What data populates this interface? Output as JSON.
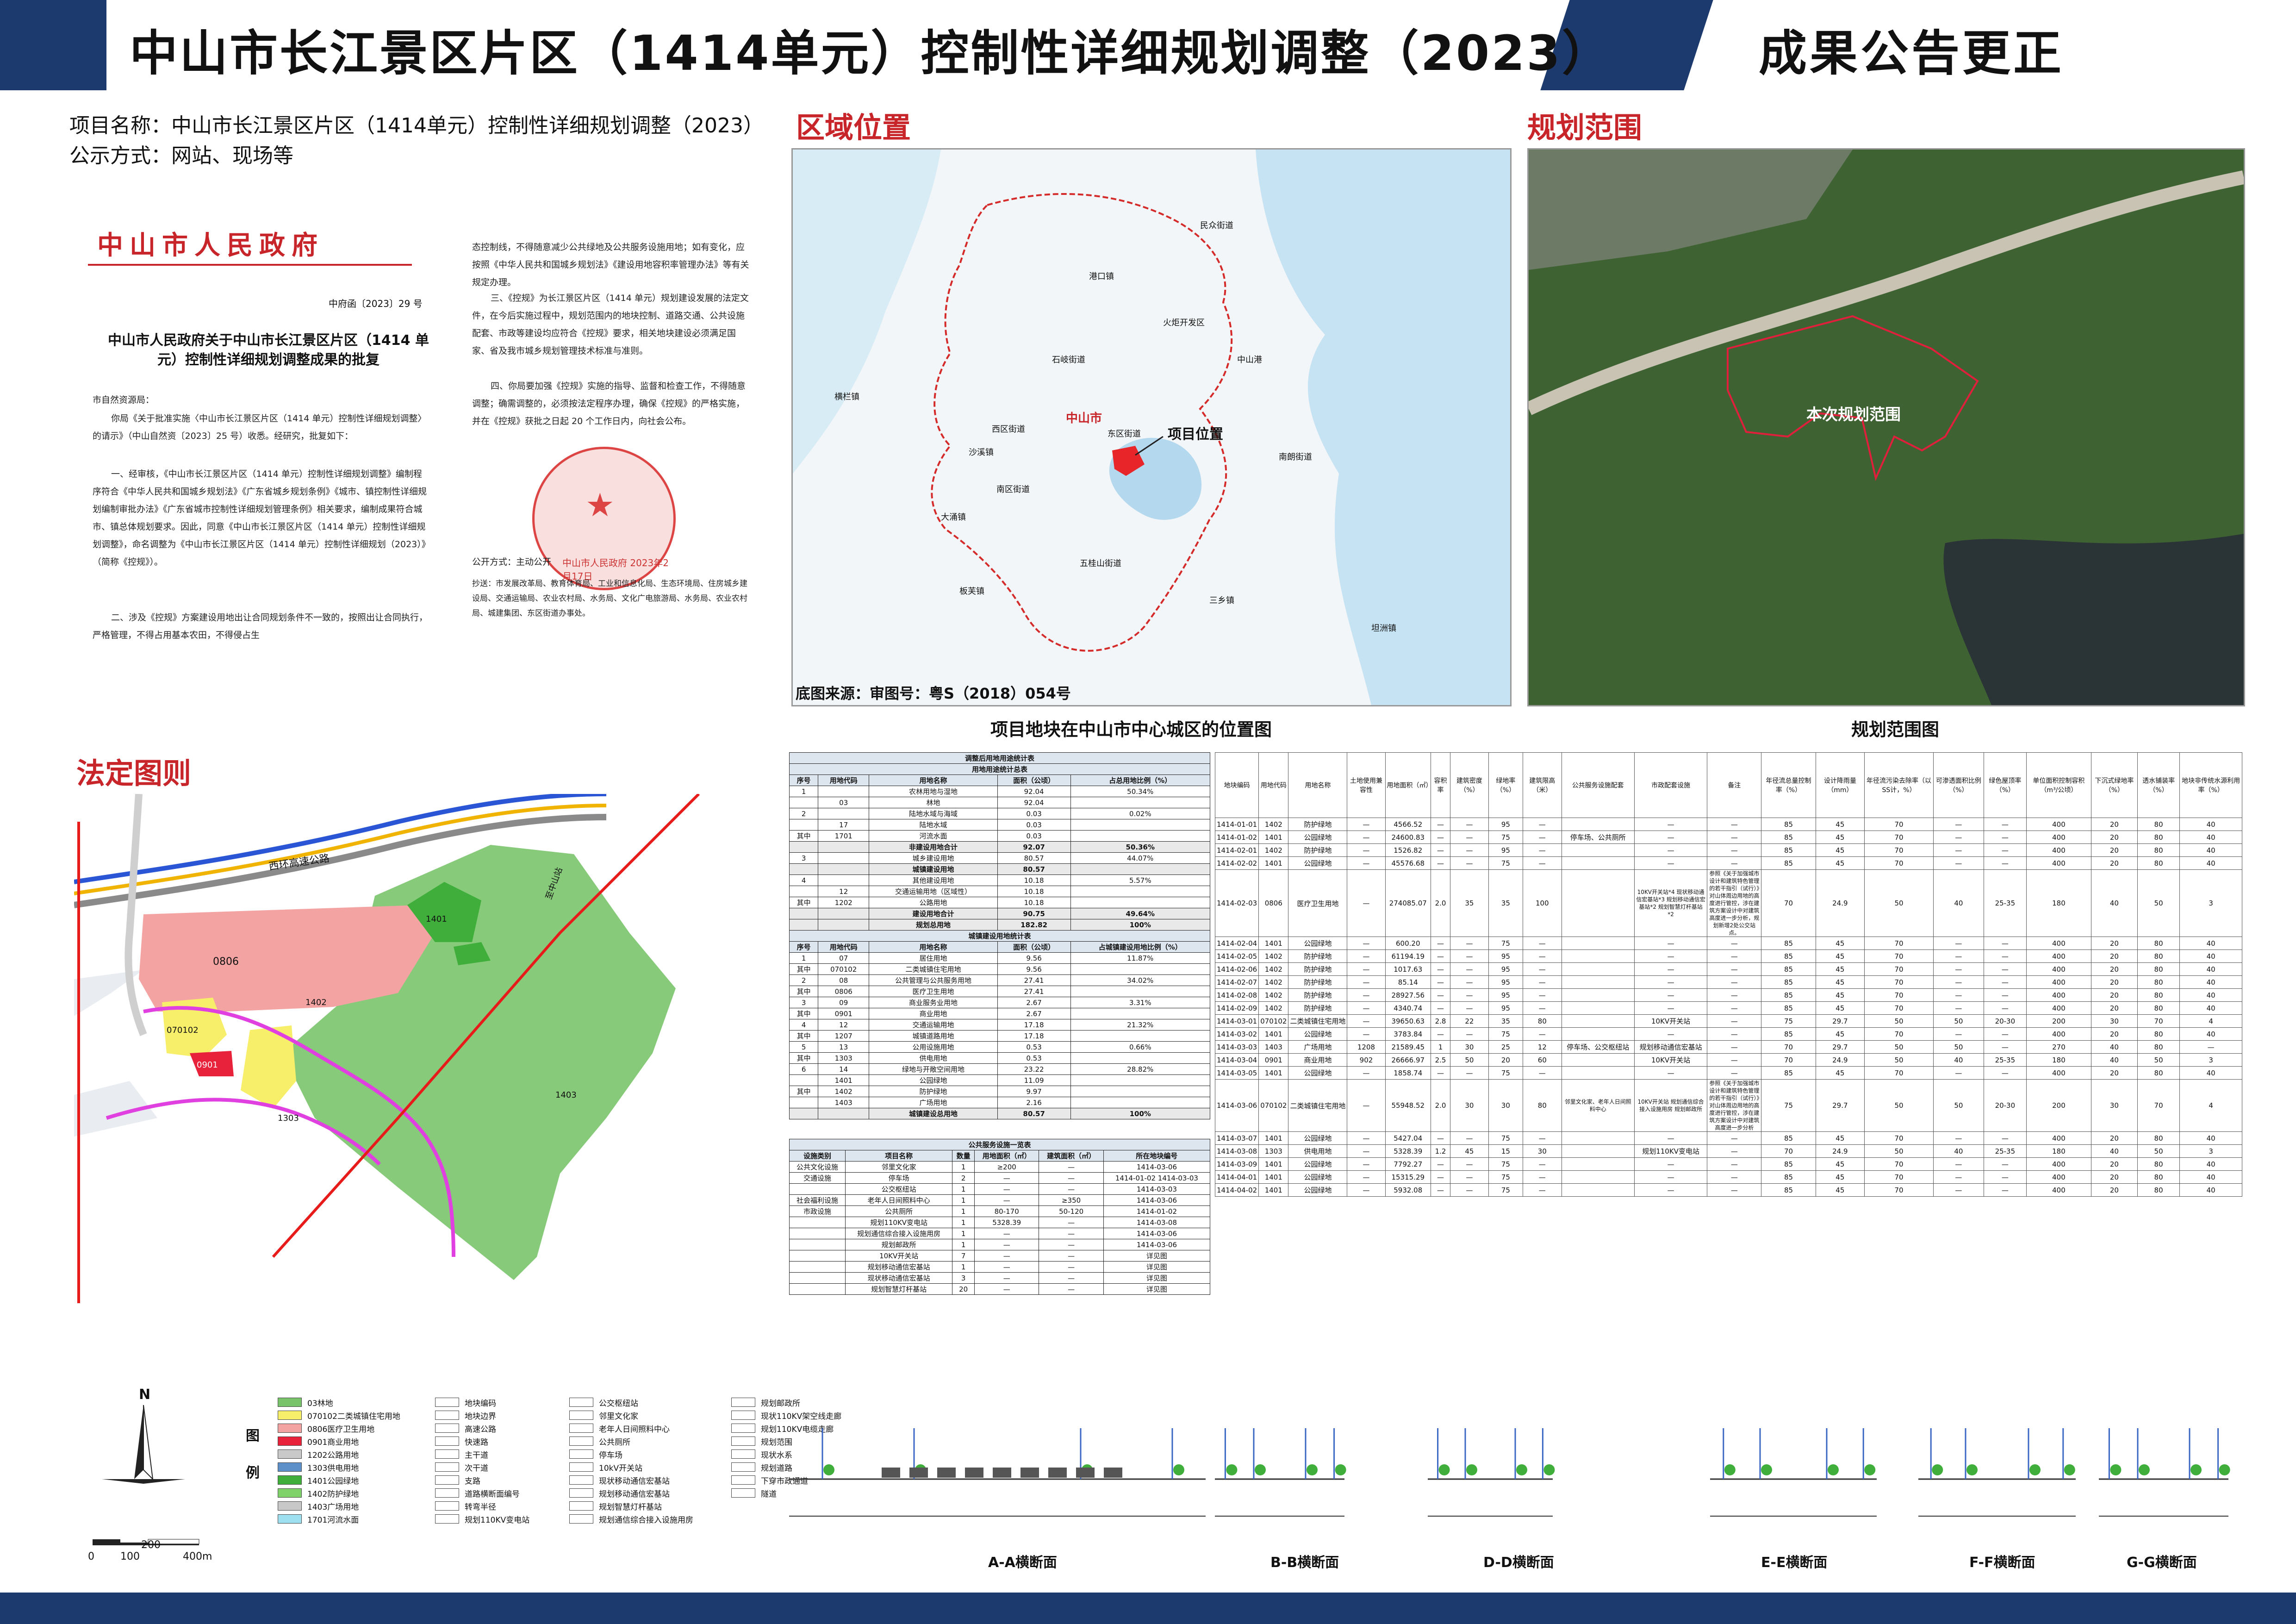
{
  "header": {
    "title": "中山市长江景区片区（1414单元）控制性详细规划调整（2023）",
    "right_title": "成果公告更正"
  },
  "project": {
    "name_line": "项目名称：中山市长江景区片区（1414单元）控制性详细规划调整（2023）",
    "method_line": "公示方式：网站、现场等"
  },
  "sections": {
    "location": "区域位置",
    "scope": "规划范围",
    "statutory": "法定图则"
  },
  "document": {
    "issuer": "中山市人民政府",
    "doc_no": "中府函〔2023〕29 号",
    "title": "中山市人民政府关于中山市长江景区片区（1414 单元）控制性详细规划调整成果的批复",
    "salutation": "市自然资源局：",
    "p1": "你局《关于批准实施〈中山市长江景区片区（1414 单元）控制性详细规划调整〉的请示》（中山自然资〔2023〕25 号）收悉。经研究，批复如下：",
    "p2": "一、经审核，《中山市长江景区片区（1414 单元）控制性详细规划调整》编制程序符合《中华人民共和国城乡规划法》《广东省城乡规划条例》《城市、镇控制性详细规划编制审批办法》《广东省城市控制性详细规划管理条例》相关要求，编制成果符合城市、镇总体规划要求。因此，同意《中山市长江景区片区（1414 单元）控制性详细规划调整》，命名调整为《中山市长江景区片区（1414 单元）控制性详细规划（2023）》（简称《控规》）。",
    "p3": "二、涉及《控规》方案建设用地出让合同规划条件不一致的，按照出让合同执行，严格管理，不得占用基本农田，不得侵占生",
    "p4": "态控制线，不得随意减少公共绿地及公共服务设施用地；如有变化，应按照《中华人民共和国城乡规划法》《建设用地容积率管理办法》等有关规定办理。",
    "p5": "三、《控规》为长江景区片区（1414 单元）规划建设发展的法定文件，在今后实施过程中，规划范围内的地块控制、道路交通、公共设施配套、市政等建设均应符合《控规》要求，相关地块建设必须满足国家、省及我市城乡规划管理技术标准与准则。",
    "p6": "四、你局要加强《控规》实施的指导、监督和检查工作，不得随意调整；确需调整的，必须按法定程序办理，确保《控规》的严格实施，并在《控规》获批之日起 20 个工作日内，向社会公布。",
    "seal_text": "中山市人民政府 2023年2月17日",
    "public_mode": "公开方式：主动公开",
    "cc": "抄送：市发展改革局、教育体育局、工业和信息化局、生态环境局、住房城乡建设局、交通运输局、农业农村局、水务局、文化广电旅游局、水务局、农业农村局、城建集团、东区街道办事处。"
  },
  "location_map": {
    "labels": [
      "中山市",
      "石岐街道",
      "东区街道",
      "西区街道",
      "南区街道",
      "火炬开发区",
      "五桂山街道",
      "大涌镇",
      "港口镇",
      "民众街道",
      "南朗街道",
      "三乡镇",
      "板芙镇",
      "坦洲镇",
      "沙溪镇",
      "横栏镇",
      "中山港"
    ],
    "project_label": "项目位置",
    "source": "底图来源：审图号：粤S（2018）054号",
    "caption": "项目地块在中山市中心城区的位置图"
  },
  "scope_map": {
    "label": "本次规划范围",
    "caption": "规划范围图"
  },
  "landuse_table": {
    "title": "调整后用地用途统计表",
    "sub1": "用地用途统计总表",
    "headers": [
      "序号",
      "用地代码",
      "用地名称",
      "面积（公顷）",
      "占总用地比例（%）"
    ],
    "rows1": [
      [
        "1",
        "",
        "农林用地与湿地",
        "92.04",
        "50.34%"
      ],
      [
        "",
        "03",
        "林地",
        "92.04",
        ""
      ],
      [
        "2",
        "",
        "陆地水域与海域",
        "0.03",
        "0.02%"
      ],
      [
        "",
        "17",
        "陆地水域",
        "0.03",
        ""
      ],
      [
        "其中",
        "1701",
        "河流水面",
        "0.03",
        ""
      ],
      [
        "",
        "",
        "非建设用地合计",
        "92.07",
        "50.36%"
      ],
      [
        "3",
        "",
        "城乡建设用地",
        "80.57",
        "44.07%"
      ],
      [
        "",
        "",
        "城镇建设用地",
        "80.57",
        ""
      ],
      [
        "4",
        "",
        "其他建设用地",
        "10.18",
        "5.57%"
      ],
      [
        "",
        "12",
        "交通运输用地（区域性）",
        "10.18",
        ""
      ],
      [
        "其中",
        "1202",
        "公路用地",
        "10.18",
        ""
      ],
      [
        "",
        "",
        "建设用地合计",
        "90.75",
        "49.64%"
      ],
      [
        "",
        "",
        "规划总用地",
        "182.82",
        "100%"
      ]
    ],
    "sub2": "城镇建设用地统计表",
    "headers2": [
      "序号",
      "用地代码",
      "用地名称",
      "面积（公顷）",
      "占城镇建设用地比例（%）"
    ],
    "rows2": [
      [
        "1",
        "07",
        "居住用地",
        "9.56",
        "11.87%"
      ],
      [
        "其中",
        "070102",
        "二类城镇住宅用地",
        "9.56",
        ""
      ],
      [
        "2",
        "08",
        "公共管理与公共服务用地",
        "27.41",
        "34.02%"
      ],
      [
        "其中",
        "0806",
        "医疗卫生用地",
        "27.41",
        ""
      ],
      [
        "3",
        "09",
        "商业服务业用地",
        "2.67",
        "3.31%"
      ],
      [
        "其中",
        "0901",
        "商业用地",
        "2.67",
        ""
      ],
      [
        "4",
        "12",
        "交通运输用地",
        "17.18",
        "21.32%"
      ],
      [
        "其中",
        "1207",
        "城镇道路用地",
        "17.18",
        ""
      ],
      [
        "5",
        "13",
        "公用设施用地",
        "0.53",
        "0.66%"
      ],
      [
        "其中",
        "1303",
        "供电用地",
        "0.53",
        ""
      ],
      [
        "6",
        "14",
        "绿地与开敞空间用地",
        "23.22",
        "28.82%"
      ],
      [
        "",
        "1401",
        "公园绿地",
        "11.09",
        ""
      ],
      [
        "其中",
        "1402",
        "防护绿地",
        "9.97",
        ""
      ],
      [
        "",
        "1403",
        "广场用地",
        "2.16",
        ""
      ],
      [
        "",
        "",
        "城镇建设总用地",
        "80.57",
        "100%"
      ]
    ]
  },
  "facility_table": {
    "title": "公共服务设施一览表",
    "headers": [
      "设施类别",
      "项目名称",
      "数量",
      "用地面积（㎡）",
      "建筑面积（㎡）",
      "所在地块编号"
    ],
    "rows": [
      [
        "公共文化设施",
        "邻里文化家",
        "1",
        "≥200",
        "—",
        "1414-03-06"
      ],
      [
        "交通设施",
        "停车场",
        "2",
        "—",
        "—",
        "1414-01-02 1414-03-03"
      ],
      [
        "",
        "公交枢纽站",
        "1",
        "—",
        "—",
        "1414-03-03"
      ],
      [
        "社会福利设施",
        "老年人日间照料中心",
        "1",
        "—",
        "≥350",
        "1414-03-06"
      ],
      [
        "市政设施",
        "公共厕所",
        "1",
        "80-170",
        "50-120",
        "1414-01-02"
      ],
      [
        "",
        "规划110KV变电站",
        "1",
        "5328.39",
        "—",
        "1414-03-08"
      ],
      [
        "",
        "规划通信综合接入设施用房",
        "1",
        "—",
        "—",
        "1414-03-06"
      ],
      [
        "",
        "规划邮政所",
        "1",
        "—",
        "—",
        "1414-03-06"
      ],
      [
        "",
        "10KV开关站",
        "7",
        "—",
        "—",
        "详见图"
      ],
      [
        "",
        "规划移动通信宏基站",
        "1",
        "—",
        "—",
        "详见图"
      ],
      [
        "",
        "现状移动通信宏基站",
        "3",
        "—",
        "—",
        "详见图"
      ],
      [
        "",
        "规划智慧灯杆基站",
        "20",
        "—",
        "—",
        "详见图"
      ]
    ]
  },
  "parcel_table": {
    "headers": [
      "地块编码",
      "用地代码",
      "用地名称",
      "土地使用兼容性",
      "用地面积（㎡）",
      "容积率",
      "建筑密度（%）",
      "绿地率（%）",
      "建筑限高（米）",
      "公共服务设施配套",
      "市政配套设施",
      "备注",
      "年径流总量控制率（%）",
      "设计降雨量（mm）",
      "年径流污染去除率（以SS计，%）",
      "可渗透面积比例（%）",
      "绿色屋顶率（%）",
      "单位面积控制容积（m³/公顷）",
      "下沉式绿地率（%）",
      "透水铺装率（%）",
      "地块非传统水源利用率（%）"
    ],
    "rows": [
      [
        "1414-01-01",
        "1402",
        "防护绿地",
        "—",
        "4566.52",
        "—",
        "—",
        "95",
        "—",
        "",
        "—",
        "—",
        "85",
        "45",
        "70",
        "—",
        "—",
        "400",
        "20",
        "80",
        "40"
      ],
      [
        "1414-01-02",
        "1401",
        "公园绿地",
        "—",
        "24600.83",
        "—",
        "—",
        "75",
        "—",
        "停车场、公共厕所",
        "—",
        "—",
        "85",
        "45",
        "70",
        "—",
        "—",
        "400",
        "20",
        "80",
        "40"
      ],
      [
        "1414-02-01",
        "1402",
        "防护绿地",
        "—",
        "1526.82",
        "—",
        "—",
        "95",
        "—",
        "",
        "—",
        "—",
        "85",
        "45",
        "70",
        "—",
        "—",
        "400",
        "20",
        "80",
        "40"
      ],
      [
        "1414-02-02",
        "1401",
        "公园绿地",
        "—",
        "45576.68",
        "—",
        "—",
        "75",
        "—",
        "",
        "—",
        "—",
        "85",
        "45",
        "70",
        "—",
        "—",
        "400",
        "20",
        "80",
        "40"
      ],
      [
        "1414-02-03",
        "0806",
        "医疗卫生用地",
        "—",
        "274085.07",
        "2.0",
        "35",
        "35",
        "100",
        "",
        "10KV开关站*4 现状移动通信宏基站*3 规划移动通信宏基站*2 规划智慧灯杆基站*2",
        "参照《关于加强城市设计和建筑特色管理的若干指引（试行）》对山体周边用地的高度进行管控，涉在建筑方案设计中对建筑高度进一步分析，规划新增2处公交站点。",
        "70",
        "24.9",
        "50",
        "40",
        "25-35",
        "180",
        "40",
        "50",
        "3"
      ],
      [
        "1414-02-04",
        "1401",
        "公园绿地",
        "—",
        "600.20",
        "—",
        "—",
        "75",
        "—",
        "",
        "—",
        "—",
        "85",
        "45",
        "70",
        "—",
        "—",
        "400",
        "20",
        "80",
        "40"
      ],
      [
        "1414-02-05",
        "1402",
        "防护绿地",
        "—",
        "61194.19",
        "—",
        "—",
        "95",
        "—",
        "",
        "—",
        "—",
        "85",
        "45",
        "70",
        "—",
        "—",
        "400",
        "20",
        "80",
        "40"
      ],
      [
        "1414-02-06",
        "1402",
        "防护绿地",
        "—",
        "1017.63",
        "—",
        "—",
        "95",
        "—",
        "",
        "—",
        "—",
        "85",
        "45",
        "70",
        "—",
        "—",
        "400",
        "20",
        "80",
        "40"
      ],
      [
        "1414-02-07",
        "1402",
        "防护绿地",
        "—",
        "85.14",
        "—",
        "—",
        "95",
        "—",
        "",
        "—",
        "—",
        "85",
        "45",
        "70",
        "—",
        "—",
        "400",
        "20",
        "80",
        "40"
      ],
      [
        "1414-02-08",
        "1402",
        "防护绿地",
        "—",
        "28927.56",
        "—",
        "—",
        "95",
        "—",
        "",
        "—",
        "—",
        "85",
        "45",
        "70",
        "—",
        "—",
        "400",
        "20",
        "80",
        "40"
      ],
      [
        "1414-02-09",
        "1402",
        "防护绿地",
        "—",
        "4340.74",
        "—",
        "—",
        "95",
        "—",
        "",
        "—",
        "—",
        "85",
        "45",
        "70",
        "—",
        "—",
        "400",
        "20",
        "80",
        "40"
      ],
      [
        "1414-03-01",
        "070102",
        "二类城镇住宅用地",
        "—",
        "39650.63",
        "2.8",
        "22",
        "35",
        "80",
        "",
        "10KV开关站",
        "—",
        "75",
        "29.7",
        "50",
        "50",
        "20-30",
        "200",
        "30",
        "70",
        "4"
      ],
      [
        "1414-03-02",
        "1401",
        "公园绿地",
        "—",
        "3783.84",
        "—",
        "—",
        "75",
        "—",
        "",
        "—",
        "—",
        "85",
        "45",
        "70",
        "—",
        "—",
        "400",
        "20",
        "80",
        "40"
      ],
      [
        "1414-03-03",
        "1403",
        "广场用地",
        "1208",
        "21589.45",
        "1",
        "30",
        "25",
        "12",
        "停车场、公交枢纽站",
        "规划移动通信宏基站",
        "—",
        "70",
        "29.7",
        "50",
        "50",
        "—",
        "270",
        "40",
        "80",
        "—"
      ],
      [
        "1414-03-04",
        "0901",
        "商业用地",
        "902",
        "26666.97",
        "2.5",
        "50",
        "20",
        "60",
        "",
        "10KV开关站",
        "—",
        "70",
        "24.9",
        "50",
        "40",
        "25-35",
        "180",
        "40",
        "50",
        "3"
      ],
      [
        "1414-03-05",
        "1401",
        "公园绿地",
        "—",
        "1858.74",
        "—",
        "—",
        "75",
        "—",
        "",
        "—",
        "—",
        "85",
        "45",
        "70",
        "—",
        "—",
        "400",
        "20",
        "80",
        "40"
      ],
      [
        "1414-03-06",
        "070102",
        "二类城镇住宅用地",
        "—",
        "55948.52",
        "2.0",
        "30",
        "30",
        "80",
        "邻里文化家、老年人日间照料中心",
        "10KV开关站 规划通信综合接入设施用房 规划邮政所",
        "参照《关于加强城市设计和建筑特色管理的若干指引（试行）》对山体周边用地的高度进行管控，涉在建筑方案设计中对建筑高度进一步分析",
        "75",
        "29.7",
        "50",
        "50",
        "20-30",
        "200",
        "30",
        "70",
        "4"
      ],
      [
        "1414-03-07",
        "1401",
        "公园绿地",
        "—",
        "5427.04",
        "—",
        "—",
        "75",
        "—",
        "",
        "—",
        "—",
        "85",
        "45",
        "70",
        "—",
        "—",
        "400",
        "20",
        "80",
        "40"
      ],
      [
        "1414-03-08",
        "1303",
        "供电用地",
        "—",
        "5328.39",
        "1.2",
        "45",
        "15",
        "30",
        "",
        "规划110KV变电站",
        "—",
        "70",
        "24.9",
        "50",
        "40",
        "25-35",
        "180",
        "40",
        "50",
        "3"
      ],
      [
        "1414-03-09",
        "1401",
        "公园绿地",
        "—",
        "7792.27",
        "—",
        "—",
        "75",
        "—",
        "",
        "—",
        "—",
        "85",
        "45",
        "70",
        "—",
        "—",
        "400",
        "20",
        "80",
        "40"
      ],
      [
        "1414-04-01",
        "1401",
        "公园绿地",
        "—",
        "15315.29",
        "—",
        "—",
        "75",
        "—",
        "",
        "—",
        "—",
        "85",
        "45",
        "70",
        "—",
        "—",
        "400",
        "20",
        "80",
        "40"
      ],
      [
        "1414-04-02",
        "1401",
        "公园绿地",
        "—",
        "5932.08",
        "—",
        "—",
        "75",
        "—",
        "",
        "—",
        "—",
        "85",
        "45",
        "70",
        "—",
        "—",
        "400",
        "20",
        "80",
        "40"
      ]
    ]
  },
  "legend": {
    "title": "图例",
    "scale_labels": [
      "0",
      "100",
      "200",
      "400m"
    ],
    "north": "N",
    "landuse": [
      {
        "label": "03林地",
        "color": "#79c46b"
      },
      {
        "label": "070102二类城镇住宅用地",
        "color": "#f7ef6a"
      },
      {
        "label": "0806医疗卫生用地",
        "color": "#f4a3a3"
      },
      {
        "label": "0901商业用地",
        "color": "#e8223a"
      },
      {
        "label": "1202公路用地",
        "color": "#c9c9c9"
      },
      {
        "label": "1303供电用地",
        "color": "#5d8fc9"
      },
      {
        "label": "1401公园绿地",
        "color": "#3fae3a"
      },
      {
        "label": "1402防护绿地",
        "color": "#7fd26a"
      },
      {
        "label": "1403广场用地",
        "color": "#c8c8c8"
      },
      {
        "label": "1701河流水面",
        "color": "#9fe0f0"
      }
    ],
    "lines": [
      "地块编码",
      "地块边界",
      "高速公路",
      "快速路",
      "主干道",
      "次干道",
      "支路",
      "道路横断面编号",
      "转弯半径",
      "规划110KV变电站"
    ],
    "facilities": [
      "公交枢纽站",
      "邻里文化家",
      "老年人日间照料中心",
      "公共厕所",
      "停车场",
      "10kV开关站",
      "现状移动通信宏基站",
      "规划移动通信宏基站",
      "规划智慧灯杆基站",
      "规划通信综合接入设施用房"
    ],
    "others": [
      "规划邮政所",
      "现状110KV架空线走廊",
      "规划110KV电缆走廊",
      "规划范围",
      "现状水系",
      "规划道路",
      "下穿市政通道",
      "隧道"
    ]
  },
  "cross_sections": [
    "A-A横断面",
    "B-B横断面",
    "D-D横断面",
    "E-E横断面",
    "F-F横断面",
    "G-G横断面"
  ],
  "statutory_map": {
    "roads": [
      "西环高速公路",
      "至中山站",
      "城市主干路",
      "东部外环"
    ],
    "parcels": [
      "0806",
      "070102",
      "0901",
      "1303",
      "1401",
      "1402",
      "1403"
    ]
  }
}
